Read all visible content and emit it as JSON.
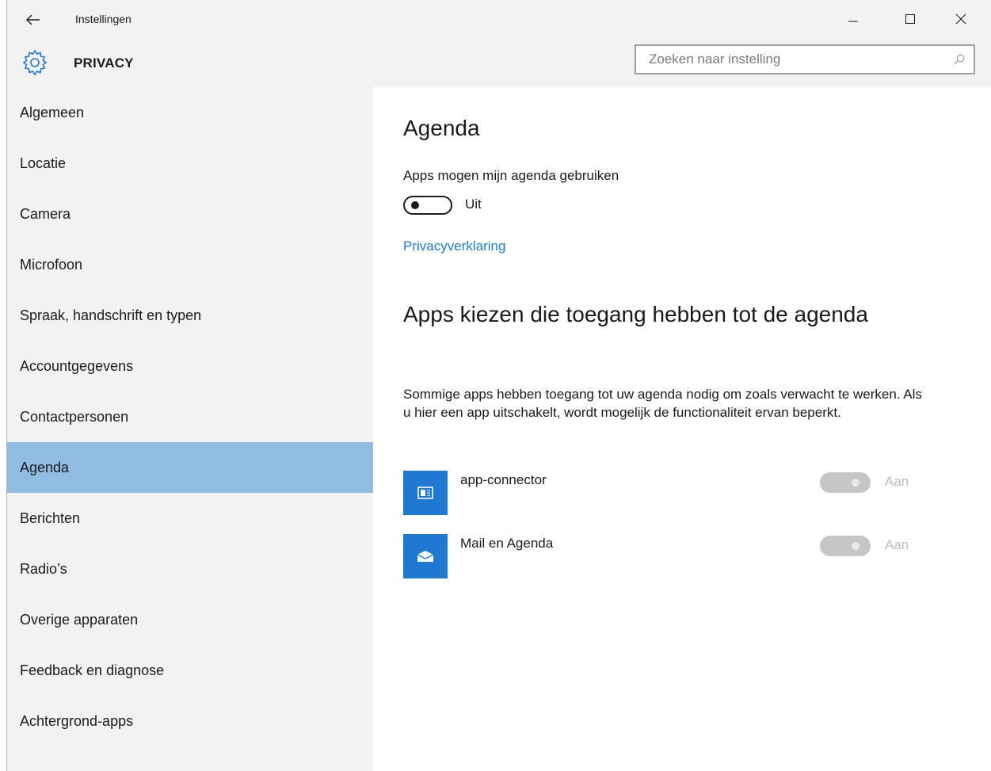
{
  "window": {
    "title": "Instellingen",
    "controls": {
      "minimize": "minimize",
      "maximize": "maximize",
      "close": "close"
    }
  },
  "header": {
    "icon": "gear-icon",
    "title": "PRIVACY",
    "search": {
      "placeholder": "Zoeken naar instelling",
      "value": ""
    }
  },
  "sidebar": {
    "selected_index": 7,
    "items": [
      {
        "label": "Algemeen"
      },
      {
        "label": "Locatie"
      },
      {
        "label": "Camera"
      },
      {
        "label": "Microfoon"
      },
      {
        "label": "Spraak, handschrift en typen"
      },
      {
        "label": "Accountgegevens"
      },
      {
        "label": "Contactpersonen"
      },
      {
        "label": "Agenda"
      },
      {
        "label": "Berichten"
      },
      {
        "label": "Radio’s"
      },
      {
        "label": "Overige apparaten"
      },
      {
        "label": "Feedback en diagnose"
      },
      {
        "label": "Achtergrond-apps"
      }
    ]
  },
  "main": {
    "heading": "Agenda",
    "permission_label": "Apps mogen mijn agenda gebruiken",
    "permission_toggle": {
      "on": false,
      "state_text": "Uit"
    },
    "privacy_link": "Privacyverklaring",
    "apps_heading": "Apps kiezen die toegang hebben tot de agenda",
    "apps_description": "Sommige apps hebben toegang tot uw agenda nodig om zoals verwacht te werken. Als u hier een app uitschakelt, wordt mogelijk de functionaliteit ervan beperkt.",
    "apps": [
      {
        "name": "app-connector",
        "icon": "app-connector-icon",
        "toggle_on": true,
        "disabled": true,
        "state_text": "Aan"
      },
      {
        "name": "Mail en Agenda",
        "icon": "mail-icon",
        "toggle_on": true,
        "disabled": true,
        "state_text": "Aan"
      }
    ]
  },
  "colors": {
    "accent": "#1f78d1",
    "link": "#1f7ac2",
    "selected_nav": "#91bde3",
    "chrome": "#f2f2f2"
  }
}
